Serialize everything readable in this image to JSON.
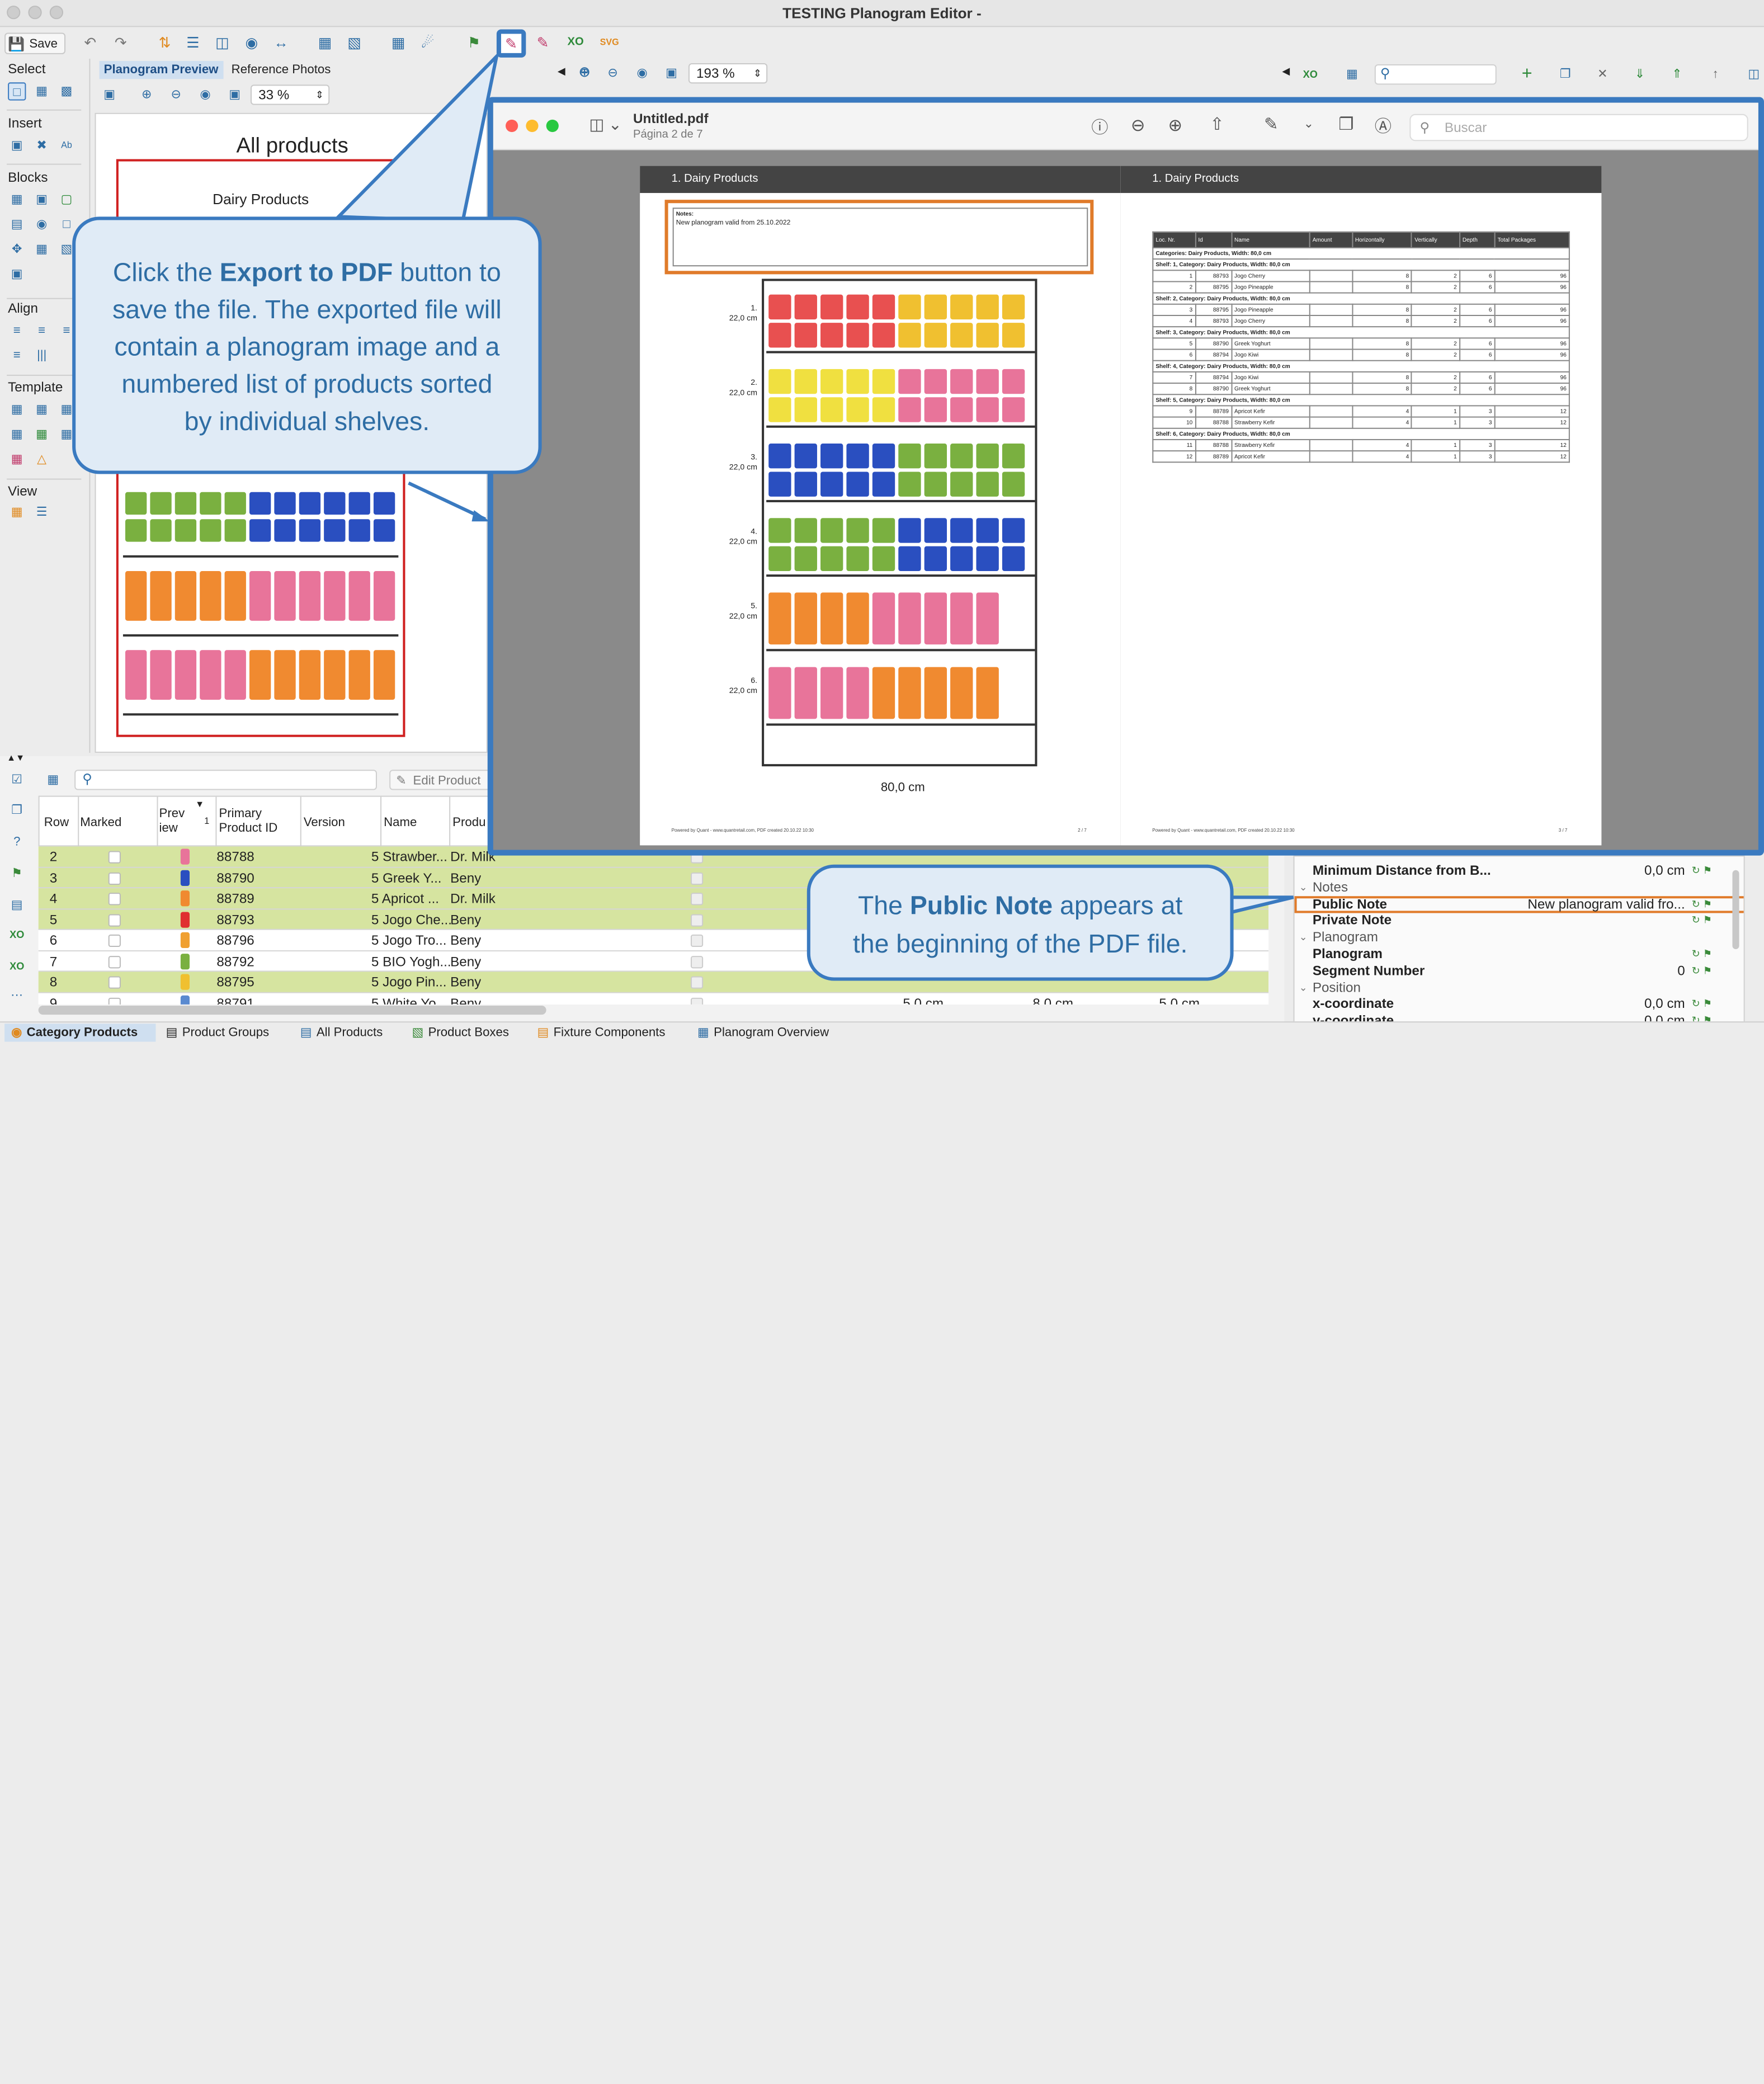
{
  "window": {
    "title": "TESTING Planogram Editor -"
  },
  "toolbar": {
    "save_label": "Save"
  },
  "left_panel": {
    "sections": [
      "Select",
      "Insert",
      "Blocks",
      "Align",
      "Template",
      "View"
    ]
  },
  "preview": {
    "tabs": [
      "Planogram Preview",
      "Reference Photos"
    ],
    "zoom": "33 %",
    "canvas_title": "All products",
    "group_title": "Dairy Products"
  },
  "editor_zoom": "193 %",
  "pdf_viewer": {
    "filename": "Untitled.pdf",
    "page_info": "Página 2 de 7",
    "search_placeholder": "Buscar",
    "page_left": {
      "header": "1. Dairy Products",
      "notes_label": "Notes:",
      "notes_text": "New planogram valid from 25.10.2022",
      "shelves": [
        {
          "label": "1.",
          "height": "22,0 cm"
        },
        {
          "label": "2.",
          "height": "22,0 cm"
        },
        {
          "label": "3.",
          "height": "22,0 cm"
        },
        {
          "label": "4.",
          "height": "22,0 cm"
        },
        {
          "label": "5.",
          "height": "22,0 cm"
        },
        {
          "label": "6.",
          "height": "22,0 cm"
        }
      ],
      "width_label": "80,0 cm",
      "footer": "Powered by Quant - www.quantretail.com, PDF created 20.10.22 10:30",
      "page_no": "2 / 7"
    },
    "page_right": {
      "header": "1. Dairy Products",
      "table_headers": [
        "Loc. Nr.",
        "Id",
        "Name",
        "Amount",
        "Horizontally",
        "Vertically",
        "Depth",
        "Total Packages"
      ],
      "rows": [
        {
          "group": "Categories: Dairy Products, Width: 80,0 cm"
        },
        {
          "group": "Shelf: 1, Category: Dairy Products, Width: 80,0 cm"
        },
        {
          "cells": [
            "1",
            "88793",
            "Jogo Cherry",
            "",
            "8",
            "2",
            "6",
            "96"
          ]
        },
        {
          "cells": [
            "2",
            "88795",
            "Jogo Pineapple",
            "",
            "8",
            "2",
            "6",
            "96"
          ]
        },
        {
          "group": "Shelf: 2, Category: Dairy Products, Width: 80,0 cm"
        },
        {
          "cells": [
            "3",
            "88795",
            "Jogo Pineapple",
            "",
            "8",
            "2",
            "6",
            "96"
          ]
        },
        {
          "cells": [
            "4",
            "88793",
            "Jogo Cherry",
            "",
            "8",
            "2",
            "6",
            "96"
          ]
        },
        {
          "group": "Shelf: 3, Category: Dairy Products, Width: 80,0 cm"
        },
        {
          "cells": [
            "5",
            "88790",
            "Greek Yoghurt",
            "",
            "8",
            "2",
            "6",
            "96"
          ]
        },
        {
          "cells": [
            "6",
            "88794",
            "Jogo Kiwi",
            "",
            "8",
            "2",
            "6",
            "96"
          ]
        },
        {
          "group": "Shelf: 4, Category: Dairy Products, Width: 80,0 cm"
        },
        {
          "cells": [
            "7",
            "88794",
            "Jogo Kiwi",
            "",
            "8",
            "2",
            "6",
            "96"
          ]
        },
        {
          "cells": [
            "8",
            "88790",
            "Greek Yoghurt",
            "",
            "8",
            "2",
            "6",
            "96"
          ]
        },
        {
          "group": "Shelf: 5, Category: Dairy Products, Width: 80,0 cm"
        },
        {
          "cells": [
            "9",
            "88789",
            "Apricot Kefir",
            "",
            "4",
            "1",
            "3",
            "12"
          ]
        },
        {
          "cells": [
            "10",
            "88788",
            "Strawberry Kefir",
            "",
            "4",
            "1",
            "3",
            "12"
          ]
        },
        {
          "group": "Shelf: 6, Category: Dairy Products, Width: 80,0 cm"
        },
        {
          "cells": [
            "11",
            "88788",
            "Strawberry Kefir",
            "",
            "4",
            "1",
            "3",
            "12"
          ]
        },
        {
          "cells": [
            "12",
            "88789",
            "Apricot Kefir",
            "",
            "4",
            "1",
            "3",
            "12"
          ]
        }
      ],
      "footer": "Powered by Quant - www.quantretail.com, PDF created 20.10.22 10:30",
      "page_no": "3 / 7"
    }
  },
  "callouts": {
    "export": {
      "p1": "Click the ",
      "b1": "Export to PDF",
      "p2": " button to save the file. The exported file will contain a planogram image and a numbered list of products sorted by individual shelves."
    },
    "note": {
      "p1": "The ",
      "b1": "Public Note",
      "p2": " appears at the beginning of the PDF file."
    }
  },
  "product_table": {
    "search_placeholder": "",
    "edit_product_label": "Edit Product",
    "columns": [
      "Row",
      "Marked",
      "Prev iew",
      "Primary Product ID",
      "Version",
      "Name",
      "Produ"
    ],
    "sort_indicator": "1",
    "rows": [
      {
        "row": "2",
        "id": "88788",
        "name": "5 Strawber...",
        "brand": "Dr. Milk",
        "hl": true
      },
      {
        "row": "3",
        "id": "88790",
        "name": "5 Greek Y...",
        "brand": "Beny",
        "hl": true
      },
      {
        "row": "4",
        "id": "88789",
        "name": "5 Apricot ...",
        "brand": "Dr. Milk",
        "hl": true
      },
      {
        "row": "5",
        "id": "88793",
        "name": "5 Jogo Che...",
        "brand": "Beny",
        "hl": true
      },
      {
        "row": "6",
        "id": "88796",
        "name": "5 Jogo Tro...",
        "brand": "Beny",
        "hl": false
      },
      {
        "row": "7",
        "id": "88792",
        "name": "5 BIO Yogh...",
        "brand": "Beny",
        "hl": false
      },
      {
        "row": "8",
        "id": "88795",
        "name": "5 Jogo Pin...",
        "brand": "Beny",
        "hl": true
      },
      {
        "row": "9",
        "id": "88791",
        "name": "5 White Yo...",
        "brand": "Beny",
        "hl": false
      }
    ],
    "dims_visible": [
      "5,0 cm",
      "8,0 cm",
      "5,0 cm"
    ]
  },
  "properties": {
    "rows": [
      {
        "label": "Minimum Distance from B...",
        "value": "0,0 cm",
        "type": "prop"
      },
      {
        "label": "Notes",
        "value": "",
        "type": "section"
      },
      {
        "label": "Public Note",
        "value": "New planogram valid fro...",
        "type": "prop",
        "highlight": true
      },
      {
        "label": "Private Note",
        "value": "",
        "type": "prop"
      },
      {
        "label": "Planogram",
        "value": "",
        "type": "section"
      },
      {
        "label": "Planogram",
        "value": "",
        "type": "prop"
      },
      {
        "label": "Segment Number",
        "value": "0",
        "type": "prop"
      },
      {
        "label": "Position",
        "value": "",
        "type": "section"
      },
      {
        "label": "x-coordinate",
        "value": "0,0 cm",
        "type": "prop"
      },
      {
        "label": "y-coordinate",
        "value": "0,0 cm",
        "type": "prop"
      }
    ]
  },
  "bottom_tabs": [
    "Category Products",
    "Product Groups",
    "All Products",
    "Product Boxes",
    "Fixture Components",
    "Planogram Overview"
  ],
  "colors": {
    "accent": "#3a7ac0",
    "highlight_row": "#d6e4a0",
    "note_border": "#e07b2a",
    "canvas_red": "#d02020"
  }
}
